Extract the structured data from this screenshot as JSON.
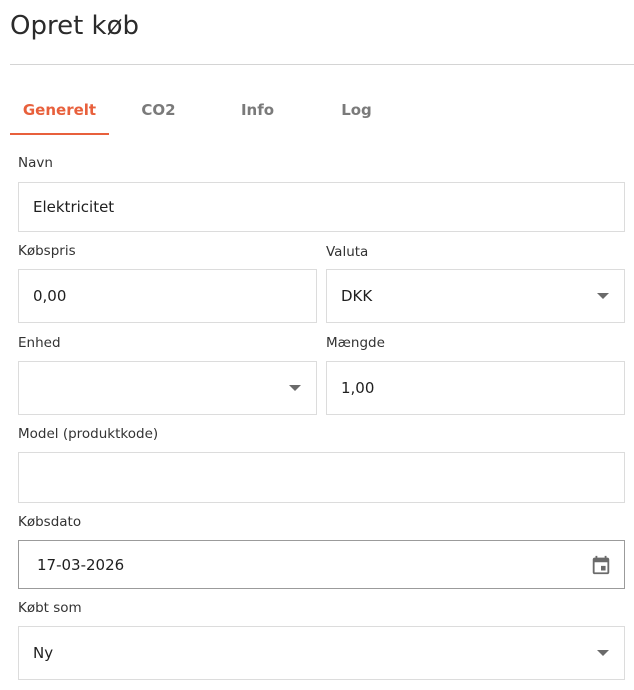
{
  "page": {
    "title": "Opret køb"
  },
  "tabs": [
    {
      "label": "Generelt",
      "active": true
    },
    {
      "label": "CO2",
      "active": false
    },
    {
      "label": "Info",
      "active": false
    },
    {
      "label": "Log",
      "active": false
    }
  ],
  "form": {
    "navn": {
      "label": "Navn",
      "value": "Elektricitet"
    },
    "kobspris": {
      "label": "Købspris",
      "value": "0,00"
    },
    "valuta": {
      "label": "Valuta",
      "value": "DKK"
    },
    "enhed": {
      "label": "Enhed",
      "value": ""
    },
    "maengde": {
      "label": "Mængde",
      "value": "1,00"
    },
    "model": {
      "label": "Model (produktkode)",
      "value": ""
    },
    "kobsdato": {
      "label": "Købsdato",
      "value": "17-03-2026"
    },
    "kobt_som": {
      "label": "Købt som",
      "value": "Ny"
    }
  },
  "icons": {
    "dropdown": "caret-down-icon",
    "calendar": "calendar-icon"
  },
  "colors": {
    "accent": "#e8603c",
    "tab_inactive": "#7a7a7a",
    "border": "#dcdcdc",
    "divider": "#d4d4d4"
  }
}
